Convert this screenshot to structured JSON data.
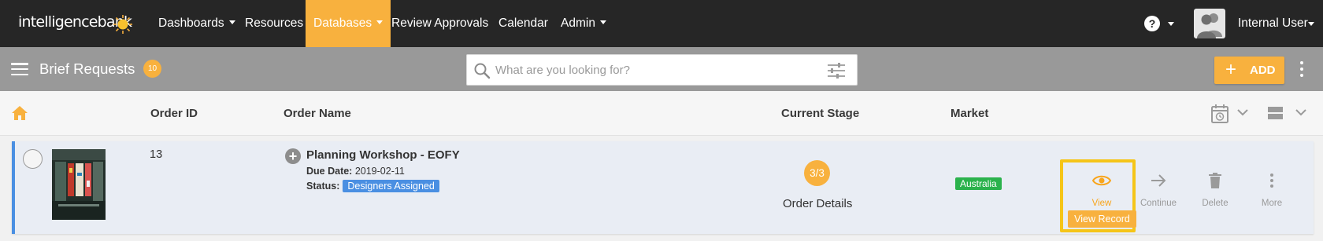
{
  "app": {
    "logo_text": "intelligencebank",
    "brand_color": "#f8b13e"
  },
  "nav": {
    "items": [
      {
        "label": "Dashboards",
        "has_dropdown": true
      },
      {
        "label": "Resources",
        "has_dropdown": false
      },
      {
        "label": "Databases",
        "has_dropdown": true,
        "active": true
      },
      {
        "label": "Review Approvals",
        "has_dropdown": false
      },
      {
        "label": "Calendar",
        "has_dropdown": false
      },
      {
        "label": "Admin",
        "has_dropdown": true
      }
    ],
    "help_icon": "question-circle-icon",
    "user_name": "Internal User"
  },
  "subheader": {
    "title": "Brief Requests",
    "count": "10",
    "search_placeholder": "What are you looking for?",
    "add_label": "ADD"
  },
  "table": {
    "columns": [
      "Order ID",
      "Order Name",
      "Current Stage",
      "Market"
    ],
    "rows": [
      {
        "order_id": "13",
        "order_name": "Planning Workshop - EOFY",
        "due_label": "Due Date:",
        "due_date": "2019-02-11",
        "status_label": "Status:",
        "status": "Designers Assigned",
        "stage": "3/3",
        "stage_name": "Order Details",
        "market": "Australia",
        "actions": {
          "view": "View",
          "view_record": "View Record",
          "continue": "Continue",
          "delete": "Delete",
          "more": "More"
        }
      }
    ]
  },
  "colors": {
    "topbar": "#262626",
    "subbar": "#999999",
    "accent": "#f8b13e",
    "status_blue": "#4a8fe2",
    "market_green": "#2bb24c",
    "highlight_yellow": "#f5c518"
  }
}
